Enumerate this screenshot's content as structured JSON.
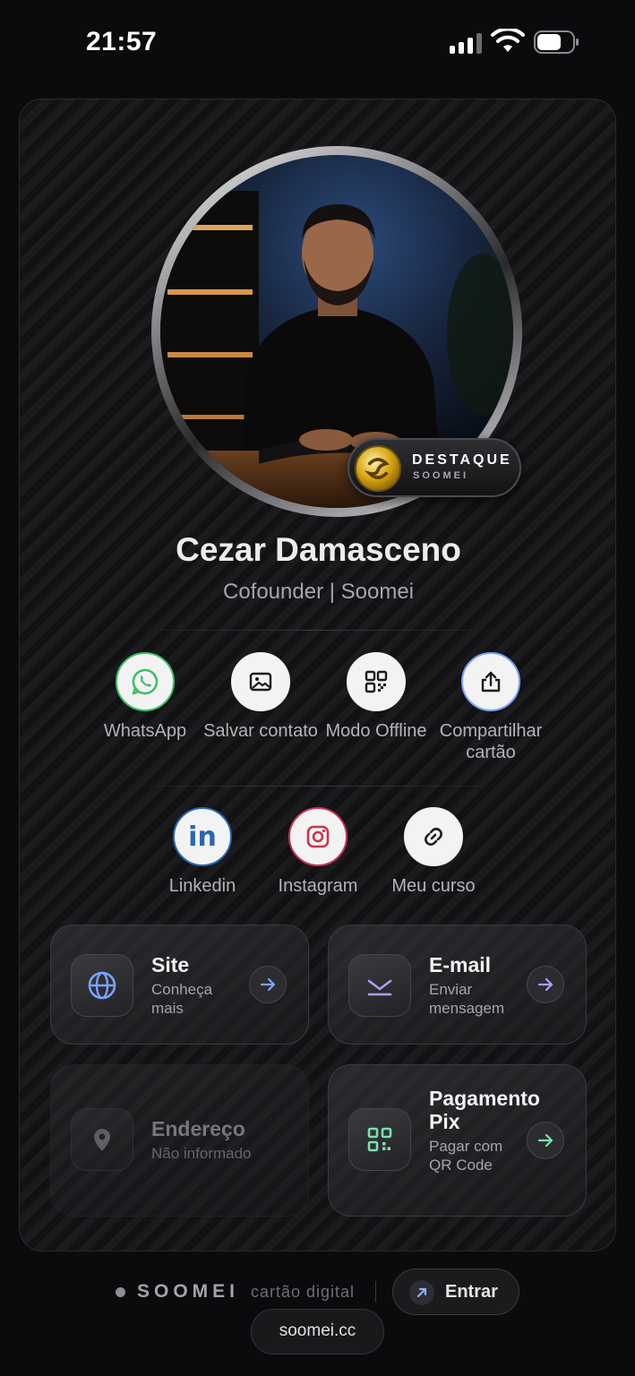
{
  "status_bar": {
    "time": "21:57"
  },
  "profile": {
    "name": "Cezar Damasceno",
    "subtitle": "Cofounder | Soomei",
    "badge": {
      "title": "DESTAQUE",
      "sub": "SOOMEI"
    }
  },
  "actions": [
    {
      "label": "WhatsApp",
      "icon": "whatsapp-icon"
    },
    {
      "label": "Salvar contato",
      "icon": "image-icon"
    },
    {
      "label": "Modo Offline",
      "icon": "qr-icon"
    },
    {
      "label": "Compartilhar cartão",
      "icon": "share-icon"
    }
  ],
  "links": [
    {
      "label": "Linkedin",
      "icon": "linkedin-icon"
    },
    {
      "label": "Instagram",
      "icon": "instagram-icon"
    },
    {
      "label": "Meu curso",
      "icon": "link-icon"
    }
  ],
  "tiles": {
    "site": {
      "title": "Site",
      "sub": "Conheça mais",
      "icon": "globe-icon"
    },
    "email": {
      "title": "E-mail",
      "sub": "Enviar mensagem",
      "icon": "email-icon"
    },
    "address": {
      "title": "Endereço",
      "sub": "Não informado",
      "icon": "location-icon"
    },
    "pix": {
      "title": "Pagamento Pix",
      "sub": "Pagar com QR Code",
      "icon": "qr-icon"
    }
  },
  "footer": {
    "brand": "SOOMEI",
    "tagline": "cartão digital",
    "enter_label": "Entrar",
    "domain": "soomei.cc"
  },
  "colors": {
    "accent_blue": "#7aa2ff",
    "accent_purple": "#b49bff",
    "accent_green": "#7be0b0",
    "whatsapp_green": "#3cc165",
    "instagram_red": "#c8354f",
    "linkedin_blue": "#2867b2"
  }
}
